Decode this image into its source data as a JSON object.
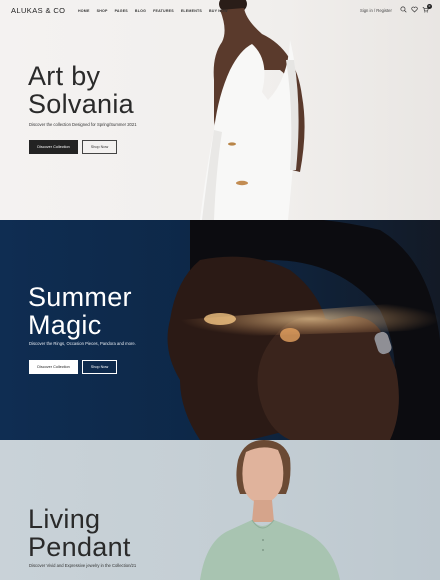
{
  "header": {
    "logo": "ALUKAS & CO",
    "nav": [
      "HOME",
      "SHOP",
      "PAGES",
      "BLOG",
      "FEATURES",
      "ELEMENTS",
      "BUY NOW"
    ],
    "auth": "Sign in / Register",
    "cart_count": "0"
  },
  "hero1": {
    "title_line1": "Art by",
    "title_line2": "Solvania",
    "subtitle": "Discover the collection Designed for Spring/Summer 2021",
    "btn_primary": "Discover Collection",
    "btn_secondary": "Shop Now"
  },
  "hero2": {
    "title_line1": "Summer",
    "title_line2": "Magic",
    "subtitle": "Discover the Rings, Occasion Pieces, Pandora and more.",
    "btn_primary": "Discover Collection",
    "btn_secondary": "Shop Now"
  },
  "hero3": {
    "title_line1": "Living",
    "title_line2": "Pendant",
    "subtitle": "Discover Vivid and Expressive jewelry in the Collection/21"
  }
}
